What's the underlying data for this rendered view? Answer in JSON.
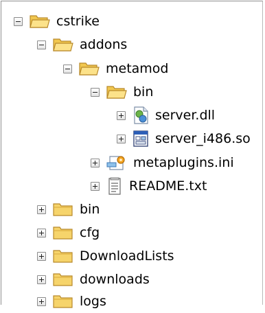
{
  "tree": {
    "cstrike": "cstrike",
    "addons": "addons",
    "metamod": "metamod",
    "bin_inner": "bin",
    "server_dll": "server.dll",
    "server_so": "server_i486.so",
    "metaplugins": "metaplugins.ini",
    "readme": "README.txt",
    "bin": "bin",
    "cfg": "cfg",
    "downloadlists": "DownloadLists",
    "downloads": "downloads",
    "logs": "logs"
  }
}
